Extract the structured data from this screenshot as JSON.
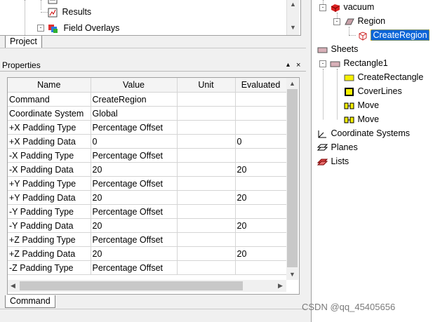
{
  "project_tree": {
    "items": [
      {
        "label": "Results"
      },
      {
        "label": "Field Overlays"
      }
    ],
    "tab": "Project"
  },
  "properties": {
    "title": "Properties",
    "title_buttons": [
      "▴",
      "×"
    ],
    "columns": [
      "Name",
      "Value",
      "Unit",
      "Evaluated"
    ],
    "rows": [
      {
        "name": "Command",
        "value": "CreateRegion",
        "unit": "",
        "evaluated": ""
      },
      {
        "name": "Coordinate System",
        "value": "Global",
        "unit": "",
        "evaluated": ""
      },
      {
        "name": "+X Padding Type",
        "value": "Percentage Offset",
        "unit": "",
        "evaluated": ""
      },
      {
        "name": "+X Padding Data",
        "value": "0",
        "unit": "",
        "evaluated": "0"
      },
      {
        "name": "-X Padding Type",
        "value": "Percentage Offset",
        "unit": "",
        "evaluated": ""
      },
      {
        "name": "-X Padding Data",
        "value": "20",
        "unit": "",
        "evaluated": "20"
      },
      {
        "name": "+Y Padding Type",
        "value": "Percentage Offset",
        "unit": "",
        "evaluated": ""
      },
      {
        "name": "+Y Padding Data",
        "value": "20",
        "unit": "",
        "evaluated": "20"
      },
      {
        "name": "-Y Padding Type",
        "value": "Percentage Offset",
        "unit": "",
        "evaluated": ""
      },
      {
        "name": "-Y Padding Data",
        "value": "20",
        "unit": "",
        "evaluated": "20"
      },
      {
        "name": "+Z Padding Type",
        "value": "Percentage Offset",
        "unit": "",
        "evaluated": ""
      },
      {
        "name": "+Z Padding Data",
        "value": "20",
        "unit": "",
        "evaluated": "20"
      },
      {
        "name": "-Z Padding Type",
        "value": "Percentage Offset",
        "unit": "",
        "evaluated": ""
      }
    ],
    "tab": "Command"
  },
  "model_tree": {
    "items": [
      {
        "label": "vacuum",
        "icon": "solid-red-icon"
      },
      {
        "label": "Region",
        "icon": "region-shape-icon"
      },
      {
        "label": "CreateRegion",
        "icon": "create-region-icon",
        "selected": true
      },
      {
        "label": "Sheets",
        "icon": "sheet-icon"
      },
      {
        "label": "Rectangle1",
        "icon": "rectangle-icon"
      },
      {
        "label": "CreateRectangle",
        "icon": "create-rectangle-icon"
      },
      {
        "label": "CoverLines",
        "icon": "cover-lines-icon"
      },
      {
        "label": "Move",
        "icon": "move-icon"
      },
      {
        "label": "Move",
        "icon": "move-icon"
      },
      {
        "label": "Coordinate Systems",
        "icon": "coordinate-systems-icon"
      },
      {
        "label": "Planes",
        "icon": "planes-icon"
      },
      {
        "label": "Lists",
        "icon": "lists-icon"
      }
    ]
  },
  "watermark": "CSDN @qq_45405656"
}
